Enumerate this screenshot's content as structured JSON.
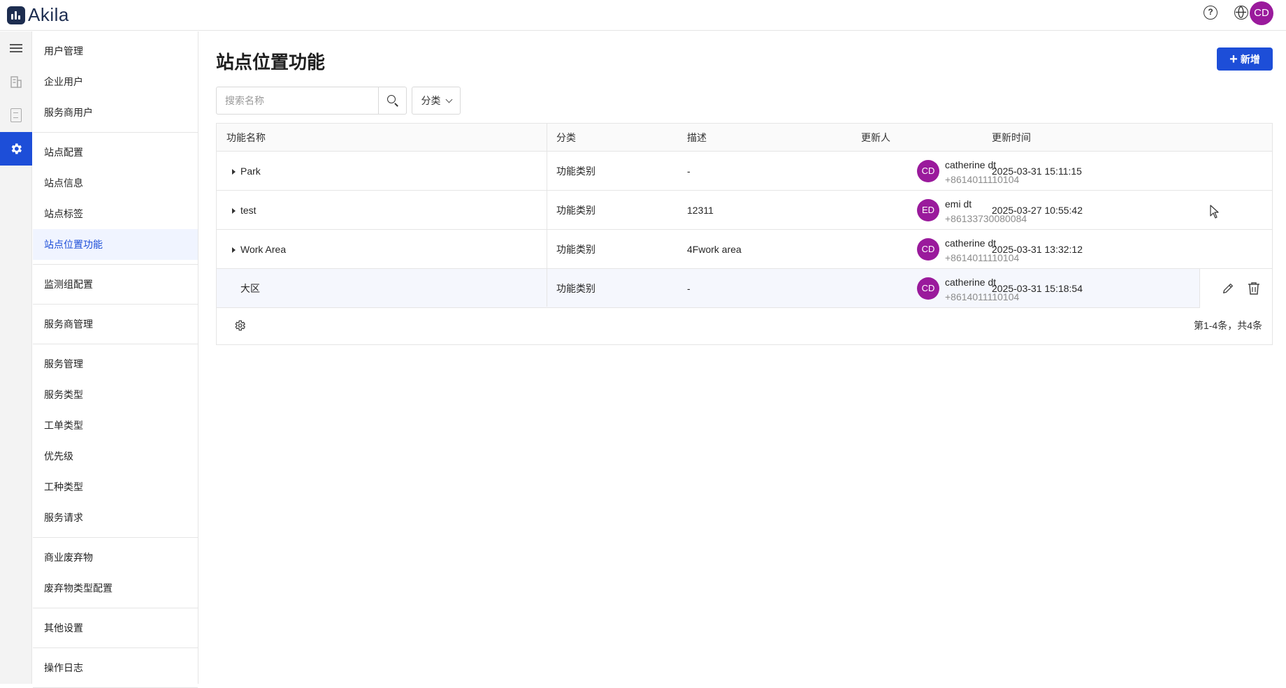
{
  "app": {
    "brand": "Akila",
    "accent_color": "#1d4ed8",
    "avatar_color": "#9a1a9c"
  },
  "topbar": {
    "help_icon": "help-icon",
    "language_icon": "globe-icon",
    "user_initials": "CD"
  },
  "rail": {
    "items": [
      "menu-icon",
      "building-icon",
      "document-icon",
      "gear-icon"
    ]
  },
  "sidebar": {
    "groups": [
      {
        "items": [
          {
            "label": "用户管理",
            "head": true
          },
          {
            "label": "企业用户"
          },
          {
            "label": "服务商用户"
          }
        ]
      },
      {
        "items": [
          {
            "label": "站点配置",
            "head": true
          },
          {
            "label": "站点信息"
          },
          {
            "label": "站点标签"
          },
          {
            "label": "站点位置功能",
            "active": true
          }
        ]
      },
      {
        "items": [
          {
            "label": "监测组配置",
            "head": true
          }
        ]
      },
      {
        "items": [
          {
            "label": "服务商管理",
            "head": true
          }
        ]
      },
      {
        "items": [
          {
            "label": "服务管理",
            "head": true
          },
          {
            "label": "服务类型"
          },
          {
            "label": "工单类型"
          },
          {
            "label": "优先级"
          },
          {
            "label": "工种类型"
          },
          {
            "label": "服务请求"
          }
        ]
      },
      {
        "items": [
          {
            "label": "商业废弃物",
            "head": true
          },
          {
            "label": "废弃物类型配置"
          }
        ]
      },
      {
        "items": [
          {
            "label": "其他设置",
            "head": true
          }
        ]
      },
      {
        "items": [
          {
            "label": "操作日志",
            "head": true
          }
        ]
      }
    ]
  },
  "page": {
    "title": "站点位置功能",
    "add_button": "新增",
    "search_placeholder": "搜索名称",
    "filter_label": "分类"
  },
  "table": {
    "columns": [
      "功能名称",
      "分类",
      "描述",
      "更新人",
      "更新时间"
    ],
    "rows": [
      {
        "name": "Park",
        "expandable": true,
        "category": "功能类别",
        "description": "-",
        "initials": "CD",
        "user": "catherine dt",
        "phone": "+8614011110104",
        "updated": "2025-03-31 15:11:15"
      },
      {
        "name": "test",
        "expandable": true,
        "category": "功能类别",
        "description": "12311",
        "initials": "ED",
        "user": "emi dt",
        "phone": "+86133730080084",
        "updated": "2025-03-27 10:55:42"
      },
      {
        "name": "Work Area",
        "expandable": true,
        "category": "功能类别",
        "description": "4Fwork area",
        "initials": "CD",
        "user": "catherine dt",
        "phone": "+8614011110104",
        "updated": "2025-03-31 13:32:12"
      },
      {
        "name": "大区",
        "expandable": false,
        "category": "功能类别",
        "description": "-",
        "initials": "CD",
        "user": "catherine dt",
        "phone": "+8614011110104",
        "updated": "2025-03-31 15:18:54",
        "hovered": true
      }
    ],
    "pagination": "第1-4条，共4条"
  }
}
